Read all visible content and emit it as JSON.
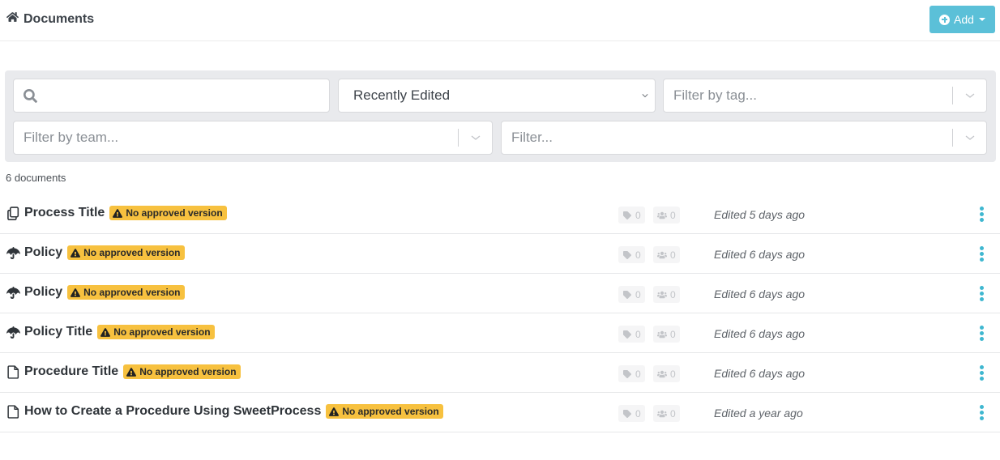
{
  "header": {
    "title": "Documents",
    "title_icon": "home-icon",
    "add_button": {
      "label": "Add",
      "icon": "plus-circle-icon",
      "caret": "caret-down-icon",
      "color": "#5bc0d8"
    }
  },
  "filters": {
    "search": {
      "value": "",
      "placeholder": "",
      "icon": "search-icon"
    },
    "sort": {
      "selected": "Recently Edited"
    },
    "tag_filter": {
      "placeholder": "Filter by tag..."
    },
    "team_filter": {
      "placeholder": "Filter by team..."
    },
    "generic_filter": {
      "placeholder": "Filter..."
    }
  },
  "document_count": "6 documents",
  "badge_color": "#f7c13f",
  "accent_color": "#3fb7d0",
  "documents": [
    {
      "type": "process",
      "icon": "copy-icon",
      "title": "Process Title",
      "badge": "No approved version",
      "tags": "0",
      "teams": "0",
      "edited": "Edited 5 days ago"
    },
    {
      "type": "policy",
      "icon": "umbrella-icon",
      "title": "Policy",
      "badge": "No approved version",
      "tags": "0",
      "teams": "0",
      "edited": "Edited 6 days ago"
    },
    {
      "type": "policy",
      "icon": "umbrella-icon",
      "title": "Policy",
      "badge": "No approved version",
      "tags": "0",
      "teams": "0",
      "edited": "Edited 6 days ago"
    },
    {
      "type": "policy",
      "icon": "umbrella-icon",
      "title": "Policy Title",
      "badge": "No approved version",
      "tags": "0",
      "teams": "0",
      "edited": "Edited 6 days ago"
    },
    {
      "type": "procedure",
      "icon": "file-icon",
      "title": "Procedure Title",
      "badge": "No approved version",
      "tags": "0",
      "teams": "0",
      "edited": "Edited 6 days ago"
    },
    {
      "type": "procedure",
      "icon": "file-icon",
      "title": "How to Create a Procedure Using SweetProcess",
      "badge": "No approved version",
      "tags": "0",
      "teams": "0",
      "edited": "Edited a year ago"
    }
  ]
}
